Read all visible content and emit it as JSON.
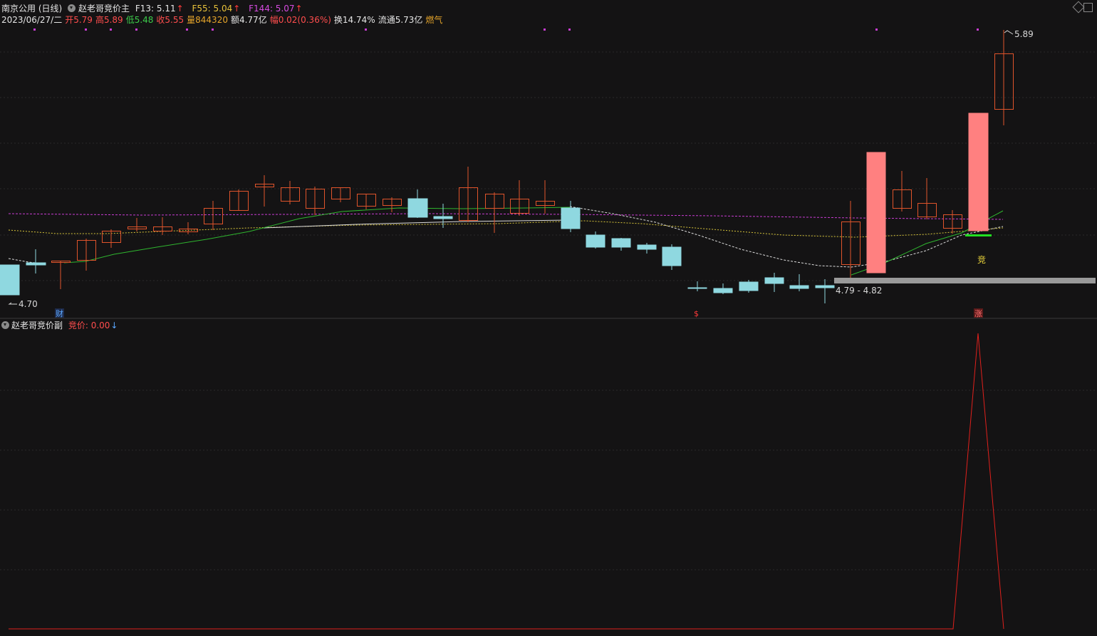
{
  "main_panel": {
    "stock_title": "南京公用 (日线)",
    "indicator_name": "赵老哥竞价主",
    "f13_label": "F13: 5.11",
    "f55_label": "F55: 5.04",
    "f144_label": "F144: 5.07",
    "date": "2023/06/27/二",
    "open": "开5.79",
    "high": "高5.89",
    "low": "低5.48",
    "close": "收5.55",
    "volume": "量844320",
    "amount": "额4.77亿",
    "change": "幅0.02(0.36%)",
    "turnover": "换14.74%",
    "float_cap": "流通5.73亿",
    "concept": "燃气",
    "high_mark": "5.89",
    "low_mark": "4.70",
    "zone_label": "4.79 - 4.82",
    "auction_mark": "竞",
    "event_markers": [
      "财",
      "$",
      "涨"
    ]
  },
  "sub_panel": {
    "indicator_name": "赵老哥竞价副",
    "auction_price_label": "竞价: 0.00"
  },
  "colors": {
    "background": "#141314",
    "up_candle": "#e0542b",
    "down_candle": "#8fd8e0",
    "big_up_candle": "#ff8080",
    "ma_green": "#2fb52f",
    "ma_white": "#dcdcdc",
    "ma_yellow_dotted": "#d6c43a",
    "ma_magenta_dotted": "#c83cd2",
    "sub_line": "#e0201c"
  }
}
